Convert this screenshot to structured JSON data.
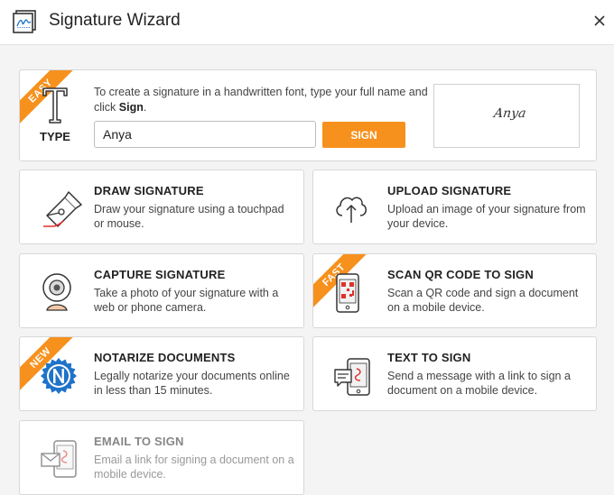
{
  "header": {
    "title": "Signature Wizard"
  },
  "type_card": {
    "badge": "EASY",
    "label": "TYPE",
    "description_prefix": "To create a signature in a handwritten font, type your full name and click ",
    "description_bold": "Sign",
    "description_suffix": ".",
    "name_value": "Anya",
    "sign_label": "SIGN",
    "preview_text": "Anya"
  },
  "cards": {
    "draw": {
      "title": "DRAW SIGNATURE",
      "desc": "Draw your signature using a touchpad or mouse."
    },
    "upload": {
      "title": "UPLOAD SIGNATURE",
      "desc": "Upload an image of your signature from your device."
    },
    "capture": {
      "title": "CAPTURE SIGNATURE",
      "desc": "Take a photo of your signature with a web or phone camera."
    },
    "scan": {
      "badge": "FAST",
      "title": "SCAN QR CODE TO SIGN",
      "desc": "Scan a QR code and sign a document on a mobile device."
    },
    "notarize": {
      "badge": "NEW",
      "title": "NOTARIZE DOCUMENTS",
      "desc": "Legally notarize your documents online in less than 15 minutes."
    },
    "text": {
      "title": "TEXT TO SIGN",
      "desc": "Send a message with a link to sign a document on a mobile device."
    },
    "email": {
      "title": "EMAIL TO SIGN",
      "desc": "Email a link for signing a document on a mobile device."
    }
  },
  "colors": {
    "accent": "#f7911d",
    "notary": "#1f73c9",
    "stroke": "#333333"
  }
}
